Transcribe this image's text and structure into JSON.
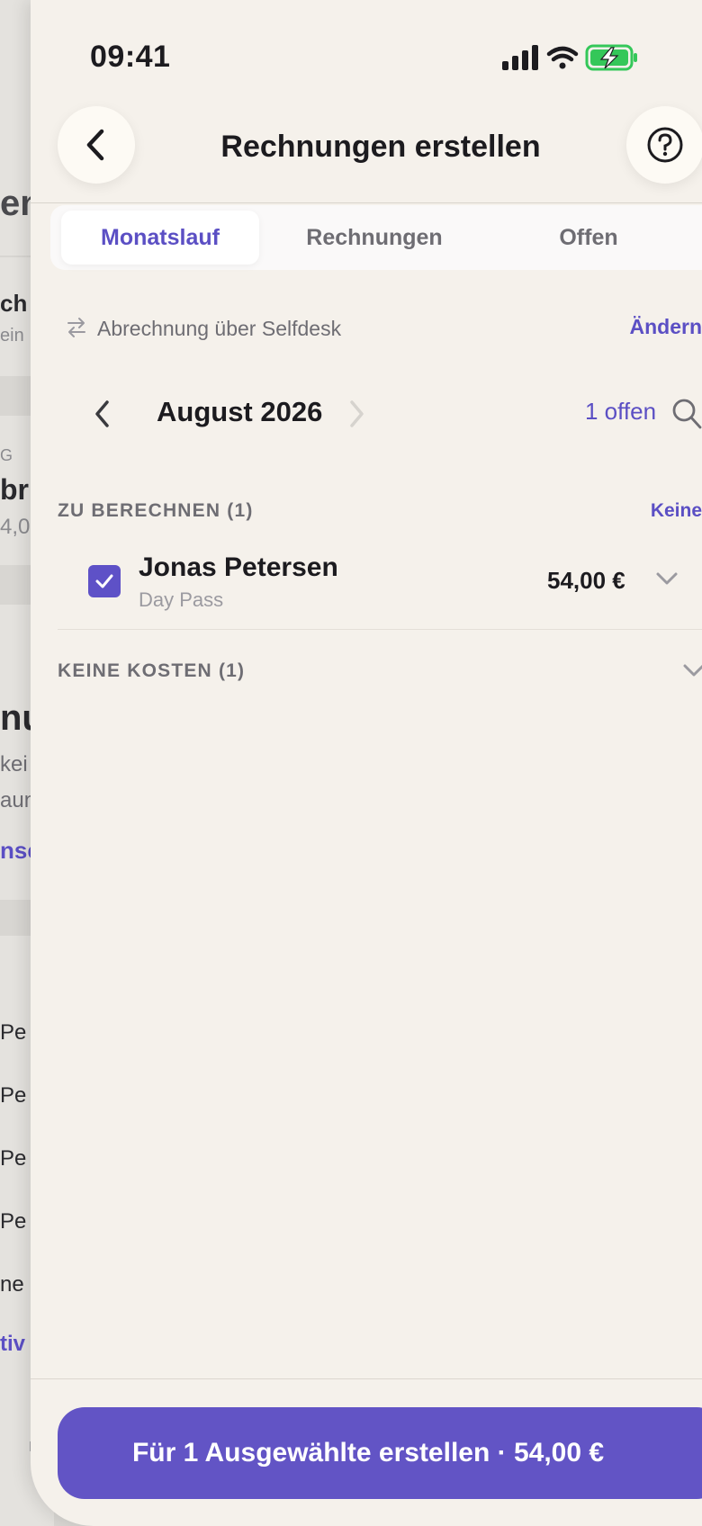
{
  "background_page": {
    "fragments": [
      "en",
      "ch",
      "ein :",
      "G",
      "br",
      "4,0",
      "nu",
      "kei",
      "aun",
      "nse",
      "Pe",
      "Pe",
      "Pe",
      "Pe",
      "ne I",
      "tiv",
      "E"
    ]
  },
  "status_bar": {
    "time": "09:41"
  },
  "nav": {
    "title": "Rechnungen erstellen"
  },
  "tabs": [
    {
      "label": "Monatslauf",
      "active": true
    },
    {
      "label": "Rechnungen",
      "active": false
    },
    {
      "label": "Offen",
      "active": false
    }
  ],
  "billing": {
    "text": "Abrechnung über Selfdesk",
    "change_label": "Ändern"
  },
  "month": {
    "label": "August 2026",
    "open_count": "1 offen"
  },
  "sections": {
    "to_bill": {
      "title": "ZU BERECHNEN (1)",
      "action": "Keine",
      "items": [
        {
          "name": "Jonas Petersen",
          "plan": "Day Pass",
          "amount": "54,00 €",
          "checked": true
        }
      ]
    },
    "no_cost": {
      "title": "KEINE KOSTEN (1)"
    }
  },
  "cta": {
    "label": "Für 1 Ausgewählte erstellen · 54,00 €"
  },
  "colors": {
    "accent": "#5b4fc4",
    "background": "#f5f1eb",
    "battery": "#34c759"
  }
}
